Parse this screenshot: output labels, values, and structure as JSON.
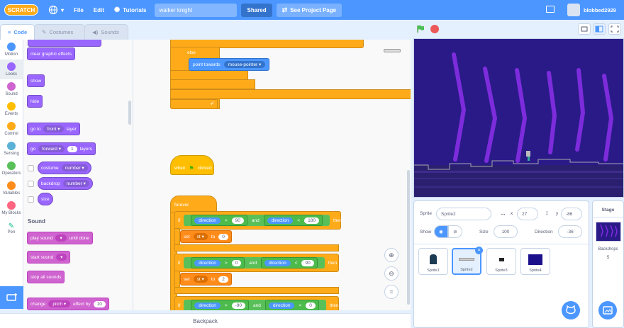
{
  "menubar": {
    "logo": "SCRATCH",
    "file": "File",
    "edit": "Edit",
    "tutorials": "Tutorials",
    "project_title": "walker knight",
    "shared": "Shared",
    "see_project": "See Project Page",
    "username": "blobbed2929"
  },
  "tabs": {
    "code": "Code",
    "costumes": "Costumes",
    "sounds": "Sounds"
  },
  "categories": [
    {
      "label": "Motion",
      "color": "#4c97ff"
    },
    {
      "label": "Looks",
      "color": "#9966ff"
    },
    {
      "label": "Sound",
      "color": "#cf63cf"
    },
    {
      "label": "Events",
      "color": "#ffbf00"
    },
    {
      "label": "Control",
      "color": "#ffab19"
    },
    {
      "label": "Sensing",
      "color": "#5cb1d6"
    },
    {
      "label": "Operators",
      "color": "#59c059"
    },
    {
      "label": "Variables",
      "color": "#ff8c1a"
    },
    {
      "label": "My Blocks",
      "color": "#ff6680"
    },
    {
      "label": "Pen",
      "color": "#0fbd8c"
    }
  ],
  "palette": {
    "clear_effects": "clear graphic effects",
    "show": "show",
    "hide": "hide",
    "goto_a": "go to",
    "goto_b": "front",
    "goto_c": "layer",
    "go_a": "go",
    "go_b": "forward",
    "go_c": "1",
    "go_d": "layers",
    "costume_a": "costume",
    "costume_b": "number",
    "backdrop_a": "backdrop",
    "backdrop_b": "number",
    "size": "size",
    "sound_head": "Sound",
    "play_a": "play sound",
    "play_b": "until done",
    "start_sound": "start sound",
    "stop_all": "stop all sounds",
    "change_a": "change",
    "change_b": "pitch",
    "change_c": "effect by",
    "change_d": "10"
  },
  "workspace": {
    "else": "else",
    "point_towards": "point towards",
    "mouse_pointer": "mouse-pointer",
    "when": "when",
    "clicked": "clicked",
    "forever": "forever",
    "if": "if",
    "direction": "direction",
    "gt": ">",
    "lt": "<",
    "and": "and",
    "then": "then",
    "set": "set",
    "st": "st",
    "to": "to",
    "v90": "90",
    "v180": "180",
    "v0": "0",
    "v0b": "0",
    "v90b": "90",
    "v2": "2",
    "vm90": "-90",
    "v0c": "0",
    "set0": "0"
  },
  "backpack": "Backpack",
  "sprite_panel": {
    "sprite_label": "Sprite",
    "sprite_name": "Sprite2",
    "x_label": "x",
    "x_value": "27",
    "y_label": "y",
    "y_value": "-86",
    "show_label": "Show",
    "size_label": "Size",
    "size_value": "100",
    "direction_label": "Direction",
    "direction_value": "-36",
    "sprites": [
      "Sprite1",
      "Sprite2",
      "Sprite3",
      "Sprite4"
    ]
  },
  "stage_panel": {
    "title": "Stage",
    "backdrops_label": "Backdrops",
    "backdrops_count": "5"
  }
}
